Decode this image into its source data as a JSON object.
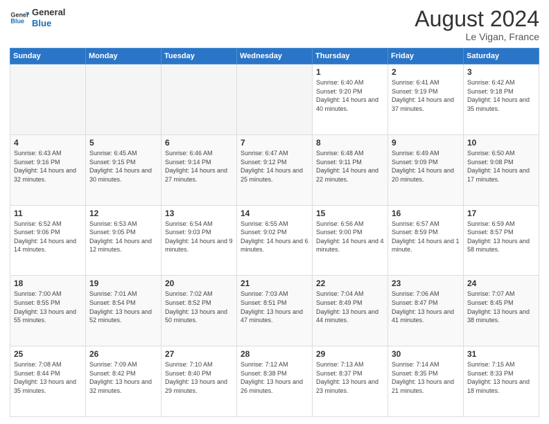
{
  "logo": {
    "line1": "General",
    "line2": "Blue"
  },
  "title": "August 2024",
  "subtitle": "Le Vigan, France",
  "days_header": [
    "Sunday",
    "Monday",
    "Tuesday",
    "Wednesday",
    "Thursday",
    "Friday",
    "Saturday"
  ],
  "weeks": [
    [
      {
        "day": "",
        "empty": true
      },
      {
        "day": "",
        "empty": true
      },
      {
        "day": "",
        "empty": true
      },
      {
        "day": "",
        "empty": true
      },
      {
        "day": "1",
        "sunrise": "6:40 AM",
        "sunset": "9:20 PM",
        "daylight": "14 hours and 40 minutes."
      },
      {
        "day": "2",
        "sunrise": "6:41 AM",
        "sunset": "9:19 PM",
        "daylight": "14 hours and 37 minutes."
      },
      {
        "day": "3",
        "sunrise": "6:42 AM",
        "sunset": "9:18 PM",
        "daylight": "14 hours and 35 minutes."
      }
    ],
    [
      {
        "day": "4",
        "sunrise": "6:43 AM",
        "sunset": "9:16 PM",
        "daylight": "14 hours and 32 minutes."
      },
      {
        "day": "5",
        "sunrise": "6:45 AM",
        "sunset": "9:15 PM",
        "daylight": "14 hours and 30 minutes."
      },
      {
        "day": "6",
        "sunrise": "6:46 AM",
        "sunset": "9:14 PM",
        "daylight": "14 hours and 27 minutes."
      },
      {
        "day": "7",
        "sunrise": "6:47 AM",
        "sunset": "9:12 PM",
        "daylight": "14 hours and 25 minutes."
      },
      {
        "day": "8",
        "sunrise": "6:48 AM",
        "sunset": "9:11 PM",
        "daylight": "14 hours and 22 minutes."
      },
      {
        "day": "9",
        "sunrise": "6:49 AM",
        "sunset": "9:09 PM",
        "daylight": "14 hours and 20 minutes."
      },
      {
        "day": "10",
        "sunrise": "6:50 AM",
        "sunset": "9:08 PM",
        "daylight": "14 hours and 17 minutes."
      }
    ],
    [
      {
        "day": "11",
        "sunrise": "6:52 AM",
        "sunset": "9:06 PM",
        "daylight": "14 hours and 14 minutes."
      },
      {
        "day": "12",
        "sunrise": "6:53 AM",
        "sunset": "9:05 PM",
        "daylight": "14 hours and 12 minutes."
      },
      {
        "day": "13",
        "sunrise": "6:54 AM",
        "sunset": "9:03 PM",
        "daylight": "14 hours and 9 minutes."
      },
      {
        "day": "14",
        "sunrise": "6:55 AM",
        "sunset": "9:02 PM",
        "daylight": "14 hours and 6 minutes."
      },
      {
        "day": "15",
        "sunrise": "6:56 AM",
        "sunset": "9:00 PM",
        "daylight": "14 hours and 4 minutes."
      },
      {
        "day": "16",
        "sunrise": "6:57 AM",
        "sunset": "8:59 PM",
        "daylight": "14 hours and 1 minute."
      },
      {
        "day": "17",
        "sunrise": "6:59 AM",
        "sunset": "8:57 PM",
        "daylight": "13 hours and 58 minutes."
      }
    ],
    [
      {
        "day": "18",
        "sunrise": "7:00 AM",
        "sunset": "8:55 PM",
        "daylight": "13 hours and 55 minutes."
      },
      {
        "day": "19",
        "sunrise": "7:01 AM",
        "sunset": "8:54 PM",
        "daylight": "13 hours and 52 minutes."
      },
      {
        "day": "20",
        "sunrise": "7:02 AM",
        "sunset": "8:52 PM",
        "daylight": "13 hours and 50 minutes."
      },
      {
        "day": "21",
        "sunrise": "7:03 AM",
        "sunset": "8:51 PM",
        "daylight": "13 hours and 47 minutes."
      },
      {
        "day": "22",
        "sunrise": "7:04 AM",
        "sunset": "8:49 PM",
        "daylight": "13 hours and 44 minutes."
      },
      {
        "day": "23",
        "sunrise": "7:06 AM",
        "sunset": "8:47 PM",
        "daylight": "13 hours and 41 minutes."
      },
      {
        "day": "24",
        "sunrise": "7:07 AM",
        "sunset": "8:45 PM",
        "daylight": "13 hours and 38 minutes."
      }
    ],
    [
      {
        "day": "25",
        "sunrise": "7:08 AM",
        "sunset": "8:44 PM",
        "daylight": "13 hours and 35 minutes."
      },
      {
        "day": "26",
        "sunrise": "7:09 AM",
        "sunset": "8:42 PM",
        "daylight": "13 hours and 32 minutes."
      },
      {
        "day": "27",
        "sunrise": "7:10 AM",
        "sunset": "8:40 PM",
        "daylight": "13 hours and 29 minutes."
      },
      {
        "day": "28",
        "sunrise": "7:12 AM",
        "sunset": "8:38 PM",
        "daylight": "13 hours and 26 minutes."
      },
      {
        "day": "29",
        "sunrise": "7:13 AM",
        "sunset": "8:37 PM",
        "daylight": "13 hours and 23 minutes."
      },
      {
        "day": "30",
        "sunrise": "7:14 AM",
        "sunset": "8:35 PM",
        "daylight": "13 hours and 21 minutes."
      },
      {
        "day": "31",
        "sunrise": "7:15 AM",
        "sunset": "8:33 PM",
        "daylight": "13 hours and 18 minutes."
      }
    ]
  ]
}
